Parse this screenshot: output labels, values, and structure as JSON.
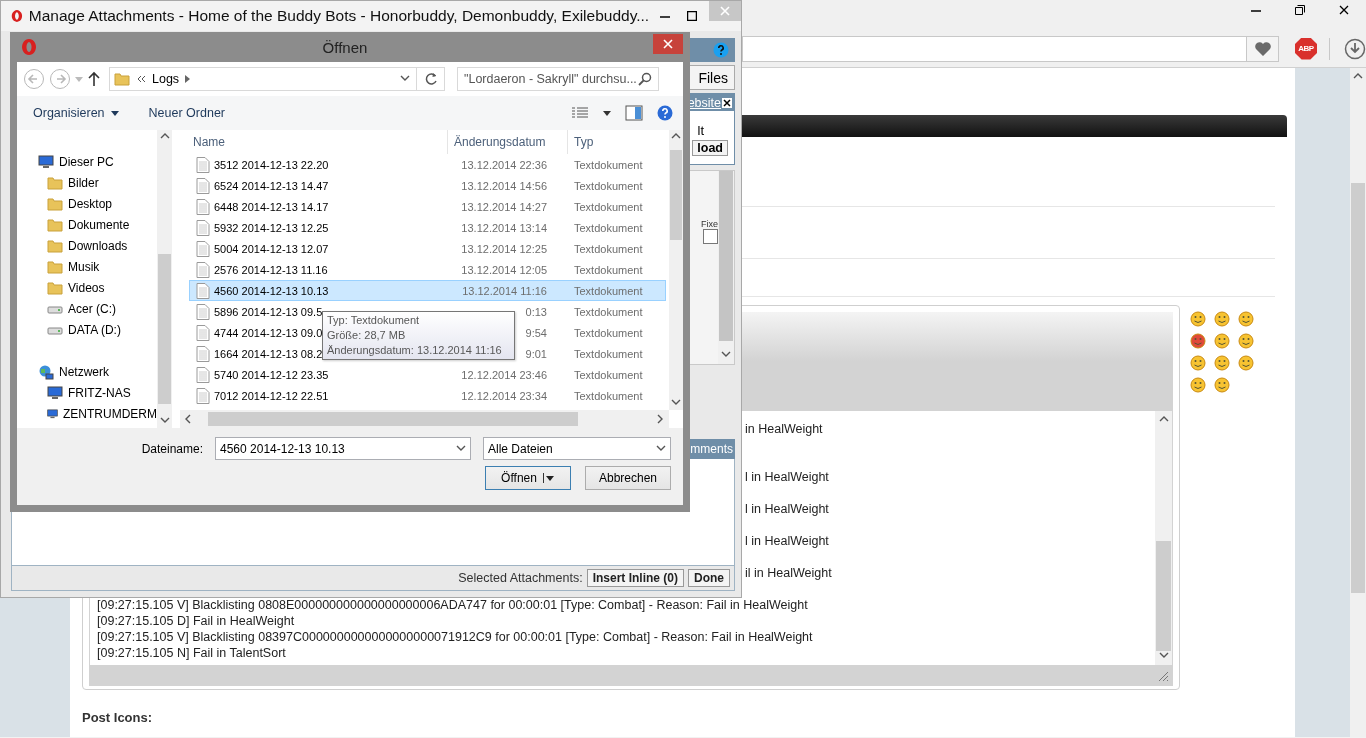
{
  "browser": {
    "adblock_label": "ABP"
  },
  "page": {
    "editor": {
      "lines": [
        {
          "kind": "fragment",
          "text": " in HealWeight"
        },
        {
          "kind": "fragment",
          "text": "l in HealWeight"
        },
        {
          "kind": "fragment",
          "text": "l in HealWeight"
        },
        {
          "kind": "fragment",
          "text": "l in HealWeight"
        },
        {
          "kind": "fragment",
          "text": "il in HealWeight"
        },
        {
          "kind": "full",
          "text": "[09:27:15.105 V] Blacklisting 0808E000000000000000000006ADA747 for 00:00:01 [Type: Combat] - Reason: Fail in HealWeight"
        },
        {
          "kind": "full",
          "text": "[09:27:15.105 D] Fail in HealWeight"
        },
        {
          "kind": "full",
          "text": "[09:27:15.105 V] Blacklisting 08397C0000000000000000000071912C9 for 00:00:01 [Type: Combat] - Reason: Fail in HealWeight"
        },
        {
          "kind": "full",
          "text": "[09:27:15.105 N] Fail in TalentSort"
        }
      ]
    },
    "post_icons_label": "Post Icons:"
  },
  "attachments": {
    "title": "Manage Attachments - Home of the Buddy Bots - Honorbuddy, Demonbuddy, Exilebuddy...",
    "files_button": "Files",
    "website_link": "ebsite",
    "alt_text": "lt",
    "upload_button": "load",
    "fixed_label": "Fixe",
    "fixed_checked": false,
    "comments_header": "mments",
    "selected_label": "Selected Attachments:",
    "insert_inline_button": "Insert Inline (0)",
    "done_button": "Done"
  },
  "open_dialog": {
    "title": "Öffnen",
    "breadcrumb": "Logs",
    "search_placeholder": "\"Lordaeron - Sakryll\" durchsu...",
    "toolbar": [
      "Organisieren",
      "Neuer Ordner"
    ],
    "nav": [
      {
        "label": "Dieser PC",
        "kind": "pc",
        "children": [
          {
            "label": "Bilder",
            "kind": "folder"
          },
          {
            "label": "Desktop",
            "kind": "folder"
          },
          {
            "label": "Dokumente",
            "kind": "folder"
          },
          {
            "label": "Downloads",
            "kind": "folder"
          },
          {
            "label": "Musik",
            "kind": "folder"
          },
          {
            "label": "Videos",
            "kind": "folder"
          },
          {
            "label": "Acer (C:)",
            "kind": "drive"
          },
          {
            "label": "DATA (D:)",
            "kind": "drive"
          }
        ]
      },
      {
        "label": "Netzwerk",
        "kind": "network",
        "children": [
          {
            "label": "FRITZ-NAS",
            "kind": "pc"
          },
          {
            "label": "ZENTRUMDERM",
            "kind": "pc"
          }
        ]
      }
    ],
    "columns": [
      "Name",
      "Änderungsdatum",
      "Typ"
    ],
    "files": [
      {
        "name": "3512 2014-12-13 22.20",
        "date": "13.12.2014 22:36",
        "type": "Textdokument",
        "selected": false
      },
      {
        "name": "6524 2014-12-13 14.47",
        "date": "13.12.2014 14:56",
        "type": "Textdokument",
        "selected": false
      },
      {
        "name": "6448 2014-12-13 14.17",
        "date": "13.12.2014 14:27",
        "type": "Textdokument",
        "selected": false
      },
      {
        "name": "5932 2014-12-13 12.25",
        "date": "13.12.2014 13:14",
        "type": "Textdokument",
        "selected": false
      },
      {
        "name": "5004 2014-12-13 12.07",
        "date": "13.12.2014 12:25",
        "type": "Textdokument",
        "selected": false
      },
      {
        "name": "2576 2014-12-13 11.16",
        "date": "13.12.2014 12:05",
        "type": "Textdokument",
        "selected": false
      },
      {
        "name": "4560 2014-12-13 10.13",
        "date": "13.12.2014 11:16",
        "type": "Textdokument",
        "selected": true
      },
      {
        "name": "5896 2014-12-13 09.5",
        "date": "0:13",
        "type": "Textdokument",
        "selected": false
      },
      {
        "name": "4744 2014-12-13 09.0",
        "date": "9:54",
        "type": "Textdokument",
        "selected": false
      },
      {
        "name": "1664 2014-12-13 08.2",
        "date": "9:01",
        "type": "Textdokument",
        "selected": false
      },
      {
        "name": "5740 2014-12-12 23.35",
        "date": "12.12.2014 23:46",
        "type": "Textdokument",
        "selected": false
      },
      {
        "name": "7012 2014-12-12 22.51",
        "date": "12.12.2014 23:34",
        "type": "Textdokument",
        "selected": false
      }
    ],
    "tooltip": [
      "Typ: Textdokument",
      "Größe: 28,7 MB",
      "Änderungsdatum: 13.12.2014 11:16"
    ],
    "filename_label": "Dateiname:",
    "filename": "4560 2014-12-13 10.13",
    "filter": "Alle Dateien",
    "buttons": [
      "Öffnen",
      "Abbrechen"
    ]
  }
}
